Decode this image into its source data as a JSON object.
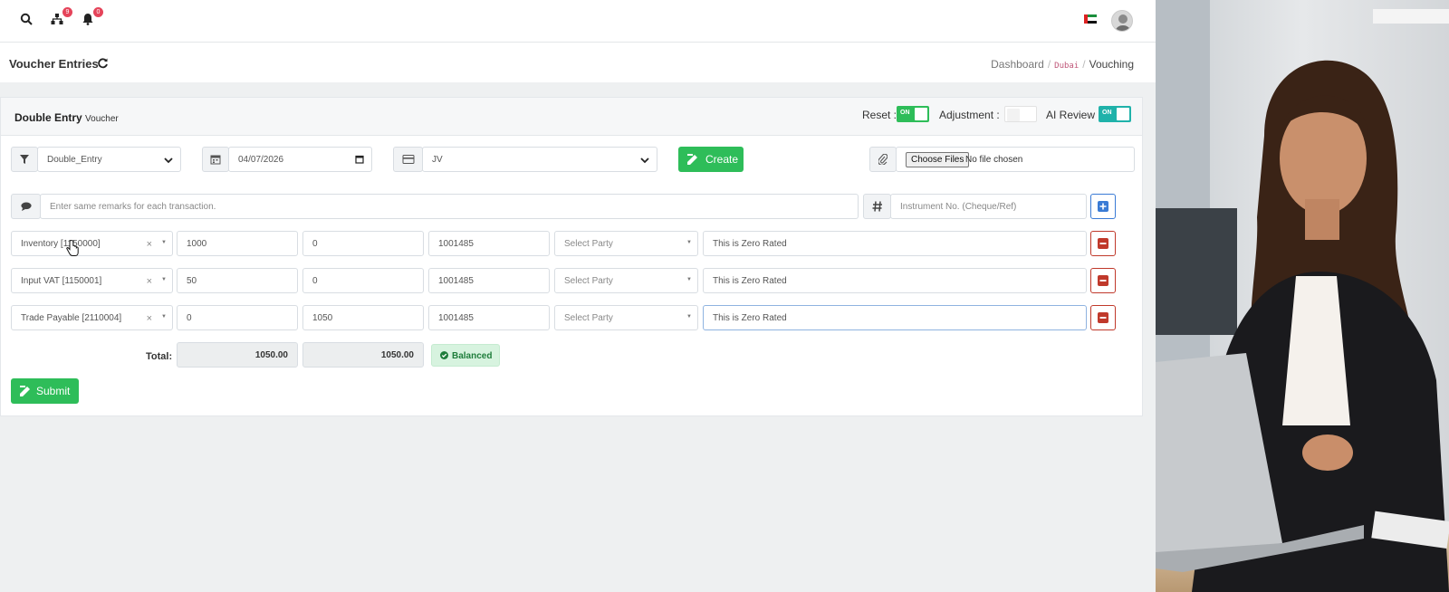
{
  "topbar": {
    "org_badge": "9",
    "notify_badge": "0"
  },
  "page": {
    "title": "Voucher Entries",
    "breadcrumb": [
      "Dashboard",
      "Dubai",
      "Vouching"
    ]
  },
  "card": {
    "title": "Double Entry",
    "title_small": "Voucher",
    "reset_label": "Reset :",
    "reset_state": "ON",
    "adjustment_label": "Adjustment :",
    "adjustment_state": "OFF",
    "ai_review_label": "AI Review :",
    "ai_review_state": "ON"
  },
  "form": {
    "voucher_type": "Double_Entry",
    "date": "04/07/2026",
    "journal": "JV",
    "create_label": "Create",
    "choose_files_label": "Choose Files",
    "no_file_text": "No file chosen",
    "remarks_placeholder": "Enter same remarks for each transaction.",
    "instrument_placeholder": "Instrument No. (Cheque/Ref)"
  },
  "entries": [
    {
      "account": "Inventory [1150000]",
      "debit": "1000",
      "credit": "0",
      "ref": "1001485",
      "party_placeholder": "Select Party",
      "remark": "This is Zero Rated"
    },
    {
      "account": "Input VAT [1150001]",
      "debit": "50",
      "credit": "0",
      "ref": "1001485",
      "party_placeholder": "Select Party",
      "remark": "This is Zero Rated"
    },
    {
      "account": "Trade Payable [2110004]",
      "debit": "0",
      "credit": "1050",
      "ref": "1001485",
      "party_placeholder": "Select Party",
      "remark": "This is Zero Rated"
    }
  ],
  "totals": {
    "label": "Total:",
    "debit": "1050.00",
    "credit": "1050.00",
    "status": "Balanced"
  },
  "submit_label": "Submit",
  "colors": {
    "primary_green": "#2ebd59",
    "toggle_teal": "#20b2aa",
    "danger_red": "#c0392b",
    "add_blue": "#3a7bd5"
  }
}
